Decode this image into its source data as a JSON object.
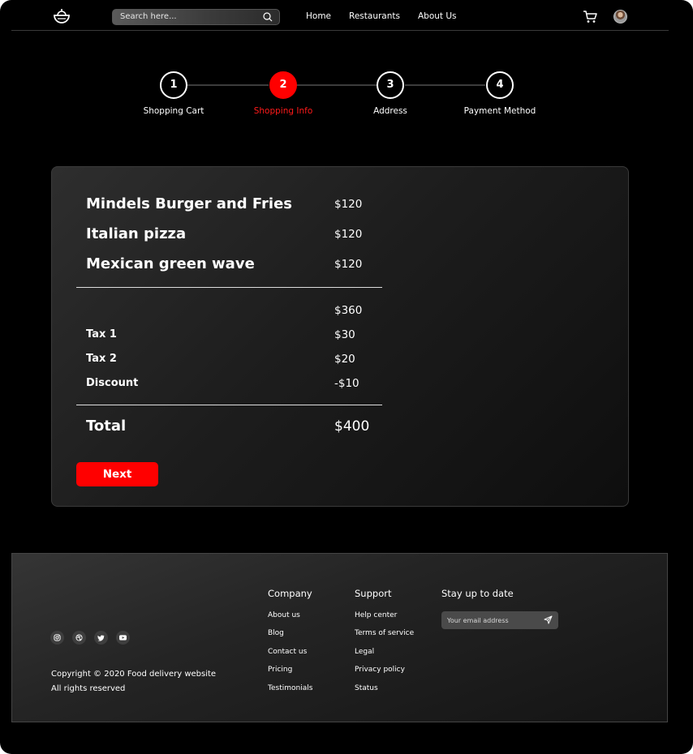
{
  "header": {
    "search_placeholder": "Search here...",
    "nav": [
      "Home",
      "Restaurants",
      "About Us"
    ]
  },
  "steps": [
    {
      "number": "1",
      "label": "Shopping Cart",
      "active": false
    },
    {
      "number": "2",
      "label": "Shopping Info",
      "active": true
    },
    {
      "number": "3",
      "label": "Address",
      "active": false
    },
    {
      "number": "4",
      "label": "Payment Method",
      "active": false
    }
  ],
  "order": {
    "items": [
      {
        "name": "Mindels Burger and Fries",
        "price": "$120"
      },
      {
        "name": "Italian pizza",
        "price": "$120"
      },
      {
        "name": "Mexican green wave",
        "price": "$120"
      }
    ],
    "subtotal": "$360",
    "charges": [
      {
        "label": "Tax 1",
        "value": "$30"
      },
      {
        "label": "Tax 2",
        "value": "$20"
      },
      {
        "label": "Discount",
        "value": "-$10"
      }
    ],
    "total_label": "Total",
    "total_value": "$400",
    "next_label": "Next"
  },
  "footer": {
    "social_icons": [
      "instagram-icon",
      "dribbble-icon",
      "twitter-icon",
      "youtube-icon"
    ],
    "copyright_line1": "Copyright © 2020 Food delivery website",
    "copyright_line2": "All rights reserved",
    "company": {
      "title": "Company",
      "links": [
        "About us",
        "Blog",
        "Contact us",
        "Pricing",
        "Testimonials"
      ]
    },
    "support": {
      "title": "Support",
      "links": [
        "Help center",
        "Terms of service",
        "Legal",
        "Privacy policy",
        "Status"
      ]
    },
    "newsletter": {
      "title": "Stay up to date",
      "placeholder": "Your email address"
    }
  },
  "colors": {
    "accent": "#ff0000",
    "background": "#000000"
  }
}
